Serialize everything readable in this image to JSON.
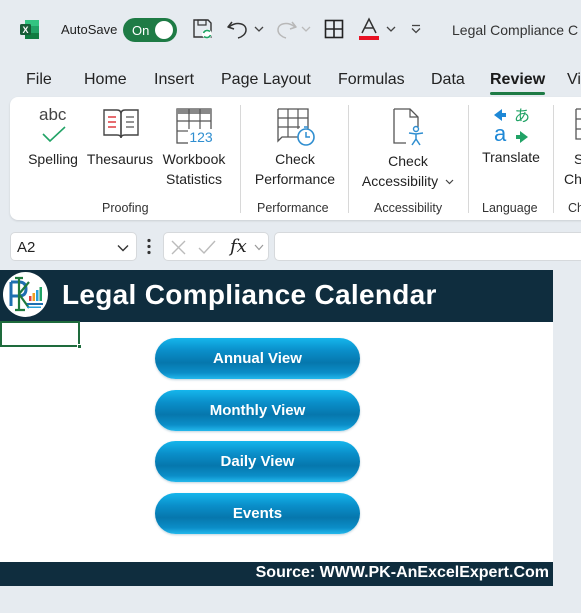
{
  "titlebar": {
    "app_icon": "excel-logo-icon",
    "autosave_label": "AutoSave",
    "autosave_state": "On",
    "qat_icons": [
      "save-icon",
      "undo-icon",
      "redo-icon",
      "borders-icon",
      "font-color-icon",
      "customize-qat-icon"
    ],
    "font_color": "#e81123",
    "document_title": "Legal Compliance C"
  },
  "menu": {
    "tabs": [
      {
        "label": "File"
      },
      {
        "label": "Home"
      },
      {
        "label": "Insert"
      },
      {
        "label": "Page Layout"
      },
      {
        "label": "Formulas"
      },
      {
        "label": "Data"
      },
      {
        "label": "Review",
        "active": true
      },
      {
        "label": "Vi"
      }
    ]
  },
  "ribbon": {
    "groups": [
      {
        "label": "Proofing",
        "buttons": [
          {
            "label": "Spelling",
            "icon": "spelling-icon",
            "icon_text": "abc"
          },
          {
            "label": "Thesaurus",
            "icon": "thesaurus-icon"
          },
          {
            "label_line1": "Workbook",
            "label_line2": "Statistics",
            "icon": "workbook-statistics-icon",
            "icon_text": "123"
          }
        ]
      },
      {
        "label": "Performance",
        "buttons": [
          {
            "label_line1": "Check",
            "label_line2": "Performance",
            "icon": "check-performance-icon"
          }
        ]
      },
      {
        "label": "Accessibility",
        "buttons": [
          {
            "label_line1": "Check",
            "label_line2": "Accessibility",
            "icon": "check-accessibility-icon"
          }
        ]
      },
      {
        "label": "Language",
        "buttons": [
          {
            "label": "Translate",
            "icon": "translate-icon",
            "icon_text_a": "a",
            "icon_text_jp": "あ"
          }
        ]
      },
      {
        "label": "Ch",
        "buttons": [
          {
            "label_line1": "S",
            "label_line2": "Ch",
            "icon": "show-changes-icon"
          }
        ]
      }
    ]
  },
  "formula_bar": {
    "name_box": "A2",
    "fx_label": "fx",
    "formula_value": ""
  },
  "sheet": {
    "title": "Legal Compliance Calendar",
    "logo": "pk-logo-icon",
    "selected_cell": "A2",
    "buttons": [
      {
        "label": "Annual View"
      },
      {
        "label": "Monthly View"
      },
      {
        "label": "Daily View"
      },
      {
        "label": "Events"
      }
    ],
    "footer": "Source: WWW.PK-AnExcelExpert.Com",
    "header_color": "#0f2d3e",
    "button_color": "#0b8ec8"
  }
}
